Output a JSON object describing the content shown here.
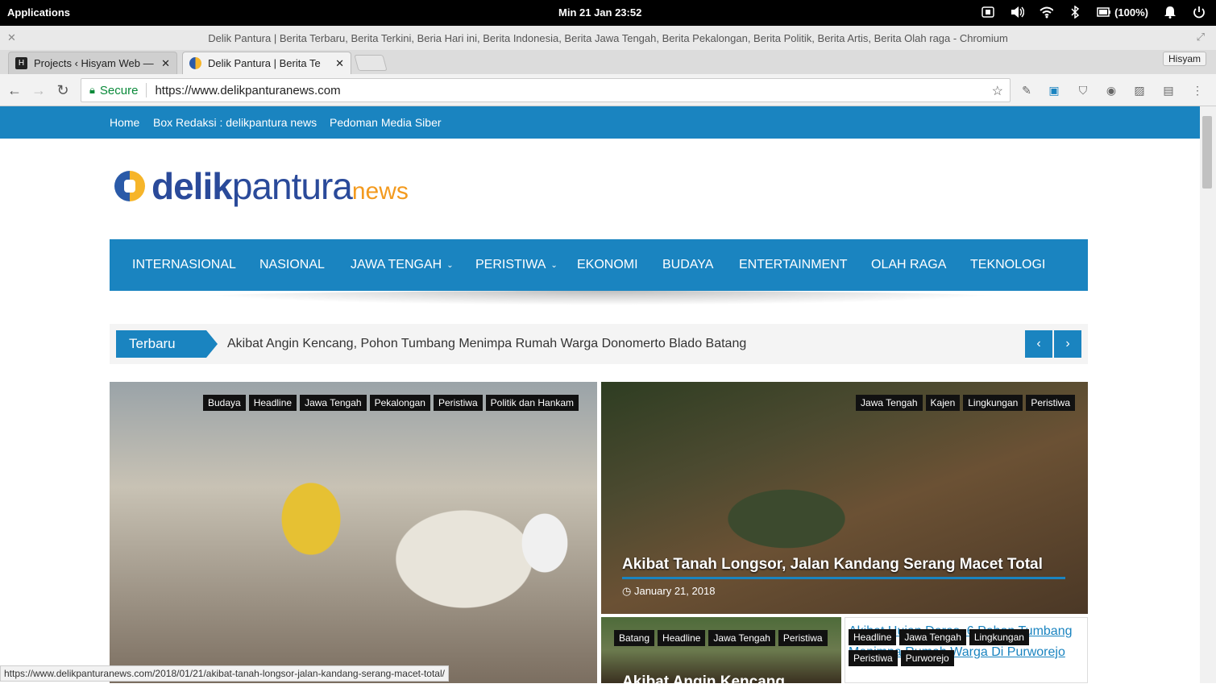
{
  "system": {
    "applications": "Applications",
    "datetime": "Min 21 Jan    23:52",
    "battery": "(100%)"
  },
  "window": {
    "title": "Delik Pantura | Berita Terbaru, Berita Terkini, Beria Hari ini, Berita Indonesia, Berita Jawa Tengah, Berita Pekalongan, Berita Politik, Berita Artis, Berita Olah raga - Chromium",
    "profile": "Hisyam"
  },
  "tabs": [
    {
      "label": "Projects ‹ Hisyam Web —",
      "favicon": "H"
    },
    {
      "label": "Delik Pantura | Berita Te",
      "favicon": "dp"
    }
  ],
  "address": {
    "secure_label": "Secure",
    "url": "https://www.delikpanturanews.com"
  },
  "site": {
    "topnav": [
      "Home",
      "Box Redaksi : delikpantura news",
      "Pedoman Media Siber"
    ],
    "logo": {
      "bold": "delik",
      "regular": "pantura",
      "suffix": "news"
    },
    "mainnav": [
      {
        "label": "INTERNASIONAL",
        "dropdown": false
      },
      {
        "label": "NASIONAL",
        "dropdown": false
      },
      {
        "label": "JAWA TENGAH",
        "dropdown": true
      },
      {
        "label": "PERISTIWA",
        "dropdown": true
      },
      {
        "label": "EKONOMI",
        "dropdown": false
      },
      {
        "label": "BUDAYA",
        "dropdown": false
      },
      {
        "label": "ENTERTAINMENT",
        "dropdown": false
      },
      {
        "label": "OLAH RAGA",
        "dropdown": false
      },
      {
        "label": "TEKNOLOGI",
        "dropdown": false
      }
    ],
    "ticker": {
      "label": "Terbaru",
      "text": "Akibat Angin Kencang, Pohon Tumbang Menimpa Rumah Warga Donomerto Blado Batang",
      "prev": "‹",
      "next": "›"
    },
    "feature_left": {
      "tags": [
        "Budaya",
        "Headline",
        "Jawa Tengah",
        "Pekalongan",
        "Peristiwa",
        "Politik dan Hankam"
      ]
    },
    "feature_right": {
      "tags": [
        "Jawa Tengah",
        "Kajen",
        "Lingkungan",
        "Peristiwa"
      ],
      "title": "Akibat Tanah Longsor, Jalan Kandang Serang Macet Total",
      "date": "January 21, 2018"
    },
    "small_left": {
      "tags": [
        "Batang",
        "Headline",
        "Jawa Tengah",
        "Peristiwa"
      ],
      "title": "Akibat Angin Kencang"
    },
    "small_right": {
      "title": "Akibat Hujan Deras, 6 Pohon Tumbang Menimpa Rumah Warga Di Purworejo",
      "tags_row1": [
        "Headline",
        "Jawa Tengah",
        "Lingkungan"
      ],
      "tags_row2": [
        "Peristiwa",
        "Purworejo"
      ]
    }
  },
  "status_url": "https://www.delikpanturanews.com/2018/01/21/akibat-tanah-longsor-jalan-kandang-serang-macet-total/"
}
